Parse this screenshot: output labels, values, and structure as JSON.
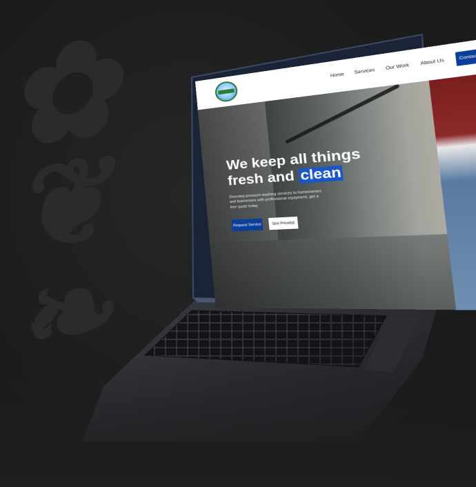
{
  "site": {
    "nav": {
      "items": [
        "Home",
        "Services",
        "Our Work",
        "About Us"
      ],
      "contact_label": "Contact Us"
    },
    "hero": {
      "title_line1": "We keep all things",
      "title_line2_prefix": "fresh and ",
      "title_highlight": "clean",
      "subtitle": "Doorstep pressure washing services to homeowners and businesses with professional equipment, get a free quote today.",
      "primary_button": "Request Service",
      "secondary_button": "See Pricelist"
    }
  },
  "colors": {
    "brand_blue": "#0b3f9a",
    "highlight_blue": "#1a56c4",
    "background": "#1f1f1f"
  }
}
